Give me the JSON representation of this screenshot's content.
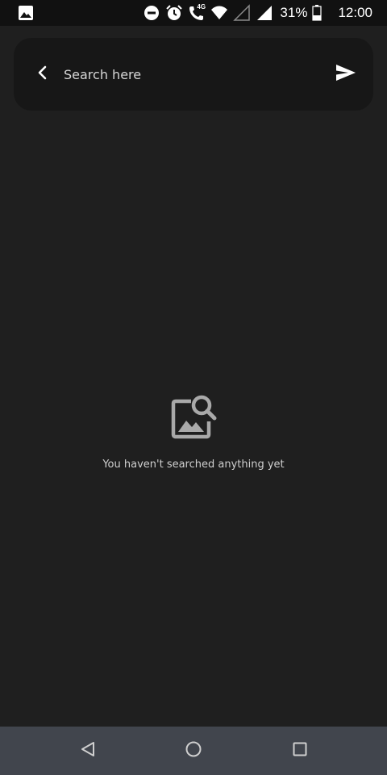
{
  "status_bar": {
    "battery_percent": "31%",
    "time": "12:00",
    "network_label": "4G",
    "icons": [
      "image-notification-icon",
      "do-not-disturb-icon",
      "alarm-icon",
      "call-4g-icon",
      "wifi-icon",
      "signal-empty-icon",
      "signal-full-icon",
      "battery-icon"
    ]
  },
  "search": {
    "placeholder": "Search here",
    "value": ""
  },
  "empty_state": {
    "message": "You haven't searched anything yet",
    "icon": "image-search-icon"
  },
  "nav_bar": {
    "icons": [
      "nav-back-icon",
      "nav-home-icon",
      "nav-recents-icon"
    ]
  },
  "colors": {
    "background": "#1f1f1f",
    "status_bar": "#111111",
    "search_bar": "#171717",
    "nav_bar": "#41454d",
    "text_primary": "#ffffff",
    "text_secondary": "#cfcfcf",
    "icon_gray": "#a9a9a9"
  }
}
